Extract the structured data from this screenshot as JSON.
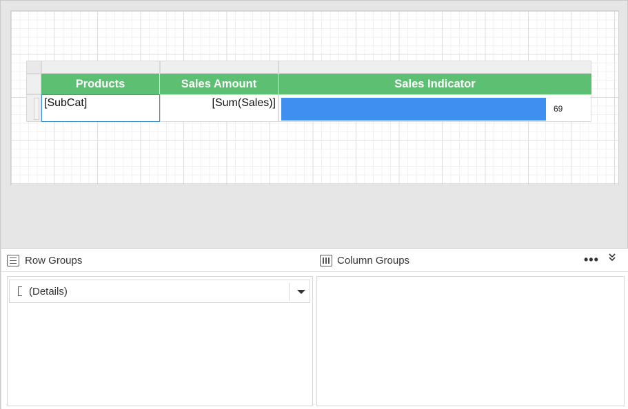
{
  "tablix": {
    "headers": [
      "Products",
      "Sales Amount",
      "Sales Indicator"
    ],
    "row": {
      "products": "[SubCat]",
      "sales_amount": "[Sum(Sales)]",
      "indicator_value": "69"
    },
    "header_color": "#5cbf72",
    "bar_color": "#3f8ff1",
    "selected_border_color": "#3a8fd6"
  },
  "groups": {
    "row_groups_label": "Row Groups",
    "column_groups_label": "Column Groups",
    "more_label": "•••",
    "collapse_label": "»",
    "row_group_items": [
      "(Details)"
    ]
  }
}
